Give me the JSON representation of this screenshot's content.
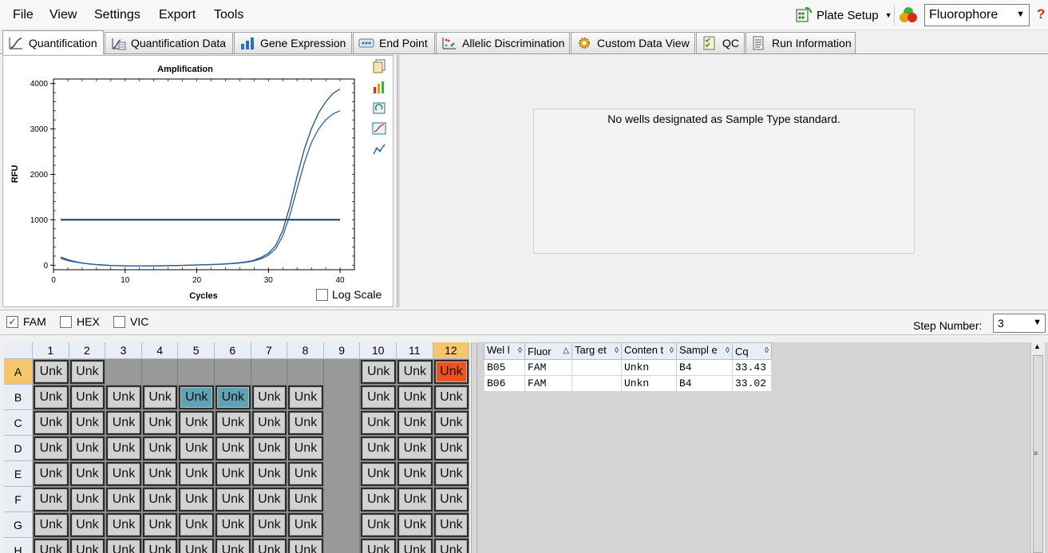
{
  "menu": {
    "items": [
      "File",
      "View",
      "Settings",
      "Export",
      "Tools"
    ],
    "plate_setup_label": "Plate Setup",
    "fluorophore_selected": "Fluorophore",
    "help_label": "?"
  },
  "tabs": [
    {
      "label": "Quantification",
      "icon": "amplification-curve-icon",
      "active": true
    },
    {
      "label": "Quantification Data",
      "icon": "data-sheet-icon",
      "active": false
    },
    {
      "label": "Gene Expression",
      "icon": "bar-chart-icon",
      "active": false
    },
    {
      "label": "End Point",
      "icon": "end-point-icon",
      "active": false
    },
    {
      "label": "Allelic Discrimination",
      "icon": "scatter-plot-icon",
      "active": false
    },
    {
      "label": "Custom Data View",
      "icon": "gear-icon",
      "active": false
    },
    {
      "label": "QC",
      "icon": "checklist-icon",
      "active": false
    },
    {
      "label": "Run Information",
      "icon": "document-icon",
      "active": false
    }
  ],
  "chart_data": {
    "type": "line",
    "title": "Amplification",
    "xlabel": "Cycles",
    "ylabel": "RFU",
    "xlim": [
      0,
      42
    ],
    "ylim": [
      -100,
      4100
    ],
    "xticks": [
      0,
      10,
      20,
      30,
      40
    ],
    "yticks": [
      0,
      1000,
      2000,
      3000,
      4000
    ],
    "grid": true,
    "threshold": 1000,
    "series": [
      {
        "color": "#1f4e8c",
        "x": [
          1,
          2,
          3,
          4,
          5,
          6,
          7,
          8,
          9,
          10,
          11,
          12,
          13,
          14,
          15,
          16,
          17,
          18,
          19,
          20,
          21,
          22,
          23,
          24,
          25,
          26,
          27,
          28,
          29,
          30,
          31,
          32,
          33,
          34,
          35,
          36,
          37,
          38,
          39,
          40
        ],
        "y": [
          180,
          120,
          80,
          50,
          30,
          15,
          5,
          -5,
          -10,
          -15,
          -20,
          -20,
          -20,
          -18,
          -15,
          -12,
          -8,
          -5,
          0,
          5,
          10,
          15,
          20,
          30,
          40,
          55,
          75,
          110,
          170,
          260,
          430,
          760,
          1300,
          1950,
          2550,
          3000,
          3350,
          3600,
          3780,
          3880
        ]
      },
      {
        "color": "#2a6296",
        "x": [
          1,
          2,
          3,
          4,
          5,
          6,
          7,
          8,
          9,
          10,
          11,
          12,
          13,
          14,
          15,
          16,
          17,
          18,
          19,
          20,
          21,
          22,
          23,
          24,
          25,
          26,
          27,
          28,
          29,
          30,
          31,
          32,
          33,
          34,
          35,
          36,
          37,
          38,
          39,
          40
        ],
        "y": [
          150,
          100,
          70,
          45,
          25,
          10,
          0,
          -8,
          -12,
          -16,
          -18,
          -18,
          -16,
          -14,
          -12,
          -10,
          -6,
          -3,
          0,
          4,
          8,
          12,
          18,
          25,
          35,
          48,
          65,
          95,
          140,
          220,
          360,
          640,
          1100,
          1680,
          2250,
          2700,
          3000,
          3200,
          3330,
          3400
        ]
      }
    ]
  },
  "chart_options": {
    "log_scale_label": "Log Scale",
    "log_scale_checked": false
  },
  "standard_curve": {
    "message": "No wells designated as Sample Type standard."
  },
  "fluors": [
    {
      "label": "FAM",
      "checked": true
    },
    {
      "label": "HEX",
      "checked": false
    },
    {
      "label": "VIC",
      "checked": false
    }
  ],
  "step": {
    "label": "Step Number:",
    "value": "3"
  },
  "plate": {
    "columns": [
      "1",
      "2",
      "3",
      "4",
      "5",
      "6",
      "7",
      "8",
      "9",
      "10",
      "11",
      "12"
    ],
    "rows": [
      "A",
      "B",
      "C",
      "D",
      "E",
      "F",
      "G",
      "H"
    ],
    "well_label": "Unk",
    "wells": [
      [
        "Unk",
        "Unk",
        "",
        "",
        "",
        "",
        "",
        "",
        "",
        "Unk",
        "Unk",
        "Unk"
      ],
      [
        "Unk",
        "Unk",
        "Unk",
        "Unk",
        "Unk",
        "Unk",
        "Unk",
        "Unk",
        "",
        "Unk",
        "Unk",
        "Unk"
      ],
      [
        "Unk",
        "Unk",
        "Unk",
        "Unk",
        "Unk",
        "Unk",
        "Unk",
        "Unk",
        "",
        "Unk",
        "Unk",
        "Unk"
      ],
      [
        "Unk",
        "Unk",
        "Unk",
        "Unk",
        "Unk",
        "Unk",
        "Unk",
        "Unk",
        "",
        "Unk",
        "Unk",
        "Unk"
      ],
      [
        "Unk",
        "Unk",
        "Unk",
        "Unk",
        "Unk",
        "Unk",
        "Unk",
        "Unk",
        "",
        "Unk",
        "Unk",
        "Unk"
      ],
      [
        "Unk",
        "Unk",
        "Unk",
        "Unk",
        "Unk",
        "Unk",
        "Unk",
        "Unk",
        "",
        "Unk",
        "Unk",
        "Unk"
      ],
      [
        "Unk",
        "Unk",
        "Unk",
        "Unk",
        "Unk",
        "Unk",
        "Unk",
        "Unk",
        "",
        "Unk",
        "Unk",
        "Unk"
      ],
      [
        "Unk",
        "Unk",
        "Unk",
        "Unk",
        "Unk",
        "Unk",
        "Unk",
        "Unk",
        "",
        "Unk",
        "Unk",
        "Unk"
      ]
    ],
    "selected_wells": [
      "B5",
      "B6"
    ],
    "highlighted_well": "A12",
    "highlighted_column": "12",
    "highlighted_row": "A",
    "colors": {
      "selected": "#5fa2b4",
      "highlight": "#f0521b",
      "well": "#d2d2d2",
      "empty": "#999999"
    }
  },
  "results_table": {
    "headers": [
      "Wel l",
      "Fluor",
      "Targ et",
      "Conten t",
      "Sampl e",
      "Cq"
    ],
    "rows": [
      [
        "B05",
        "FAM",
        "",
        "Unkn",
        "B4",
        "33.43"
      ],
      [
        "B06",
        "FAM",
        "",
        "Unkn",
        "B4",
        "33.02"
      ]
    ]
  }
}
